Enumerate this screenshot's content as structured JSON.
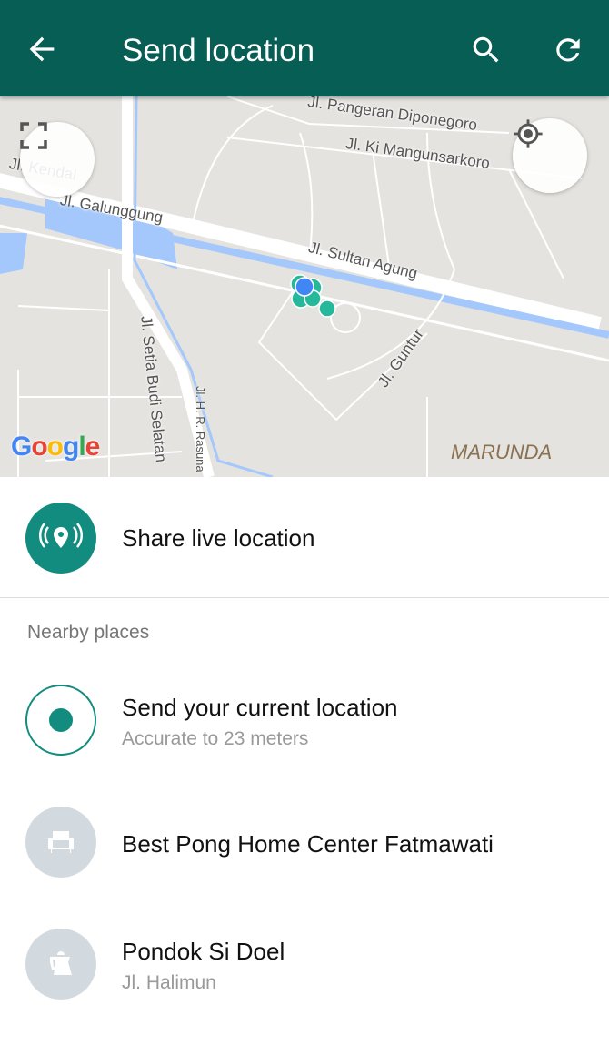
{
  "appbar": {
    "title": "Send location",
    "back_icon": "arrow-left-icon",
    "search_icon": "search-icon",
    "refresh_icon": "refresh-icon",
    "color": "#075e54"
  },
  "map": {
    "streets": [
      "Jl. Pangeran Diponegoro",
      "Jl. Ki Mangunsarkoro",
      "Jl. Kendal",
      "Jl. Galunggung",
      "Jl. Sultan Agung",
      "Jl. Setia Budi Selatan",
      "Jl. H. R. Rasuna",
      "Jl. Guntur"
    ],
    "area_label": "MARUNDA",
    "logo": "Google",
    "fullscreen_icon": "fullscreen-icon",
    "my_location_icon": "my-location-icon"
  },
  "live": {
    "label": "Share live location",
    "icon": "live-location-icon",
    "color": "#128c7e"
  },
  "nearby": {
    "header": "Nearby places",
    "items": [
      {
        "title": "Send your current location",
        "subtitle": "Accurate to 23 meters",
        "icon": "radio-selected-icon"
      },
      {
        "title": "Best Pong Home Center Fatmawati",
        "subtitle": "",
        "icon": "armchair-icon"
      },
      {
        "title": "Pondok Si Doel",
        "subtitle": "Jl. Halimun",
        "icon": "kettle-icon"
      }
    ]
  }
}
